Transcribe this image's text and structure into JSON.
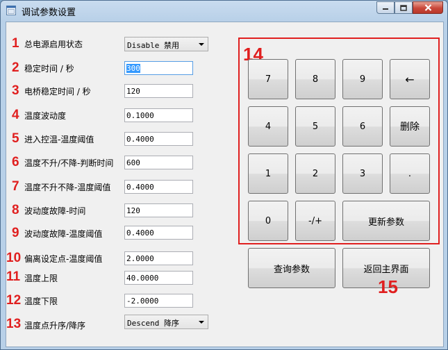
{
  "window": {
    "title": "调试参数设置"
  },
  "params": [
    {
      "num": "1",
      "label": "总电源启用状态",
      "type": "combo",
      "value": "Disable 禁用"
    },
    {
      "num": "2",
      "label": "稳定时间 / 秒",
      "type": "text",
      "value": "300",
      "selected": true
    },
    {
      "num": "3",
      "label": "电桥稳定时间 / 秒",
      "type": "text",
      "value": "120"
    },
    {
      "num": "4",
      "label": "温度波动度",
      "type": "text",
      "value": "0.1000"
    },
    {
      "num": "5",
      "label": "进入控温-温度阈值",
      "type": "text",
      "value": "0.4000"
    },
    {
      "num": "6",
      "label": "温度不升/不降-判断时间",
      "type": "text",
      "value": "600"
    },
    {
      "num": "7",
      "label": "温度不升不降-温度阈值",
      "type": "text",
      "value": "0.4000"
    },
    {
      "num": "8",
      "label": "波动度故障-时间",
      "type": "text",
      "value": "120"
    },
    {
      "num": "9",
      "label": "波动度故障-温度阈值",
      "type": "text",
      "value": "0.4000"
    },
    {
      "num": "10",
      "label": "偏离设定点-温度阈值",
      "type": "text",
      "value": "2.0000"
    },
    {
      "num": "11",
      "label": "温度上限",
      "type": "text",
      "value": "40.0000"
    },
    {
      "num": "12",
      "label": "温度下限",
      "type": "text",
      "value": "-2.0000"
    },
    {
      "num": "13",
      "label": "温度点升序/降序",
      "type": "combo",
      "value": "Descend 降序"
    }
  ],
  "keypad": {
    "marker": "14",
    "row1": [
      "7",
      "8",
      "9",
      "←"
    ],
    "row2": [
      "4",
      "5",
      "6",
      "删除"
    ],
    "row3": [
      "1",
      "2",
      "3",
      "."
    ],
    "row4": [
      "0",
      "-/+"
    ],
    "update_label": "更新参数"
  },
  "actions": {
    "query_label": "查询参数",
    "back_label": "返回主界面",
    "marker": "15"
  },
  "colors": {
    "annotation_red": "#e01f1f",
    "selection_blue": "#3399ff"
  }
}
